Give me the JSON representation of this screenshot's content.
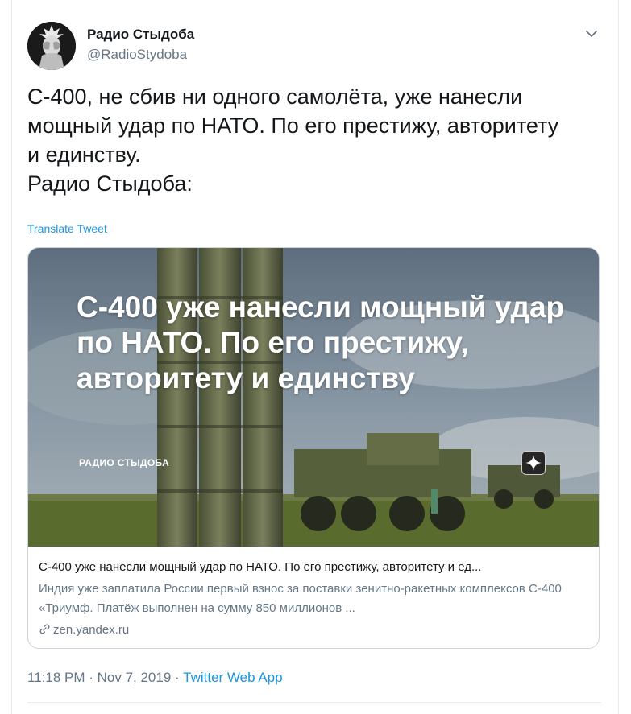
{
  "tweet": {
    "author_name": "Радио Стыдоба",
    "author_handle": "@RadioStydoba",
    "text": "С-400, не сбив ни одного самолёта, уже нанесли\nмощный удар по НАТО. По его престижу, авторитету\nи единству.\nРадио Стыдоба:",
    "translate_label": "Translate Tweet",
    "time": "11:18 PM",
    "separator1": " · ",
    "date": "Nov 7, 2019",
    "separator2": " · ",
    "source_app": "Twitter Web App"
  },
  "card": {
    "image_headline": "С-400 уже нанесли мощный удар по НАТО. По его престижу, авторитету и единству",
    "image_brand": "РАДИО СТЫДОБА",
    "title": "С-400 уже нанесли мощный удар по НАТО. По его престижу, авторитету и ед...",
    "description": "Индия уже заплатила России первый взнос за поставки зенитно-ракетных комплексов С-400 «Триумф. Платёж выполнен на сумму 850 миллионов ...",
    "domain": "zen.yandex.ru"
  },
  "colors": {
    "link_blue": "#1b95e0",
    "secondary_text": "#657786",
    "border": "#ccd6dd"
  },
  "icons": {
    "caret": "chevron-down-icon",
    "link": "link-icon",
    "zen": "zen-star-icon"
  }
}
